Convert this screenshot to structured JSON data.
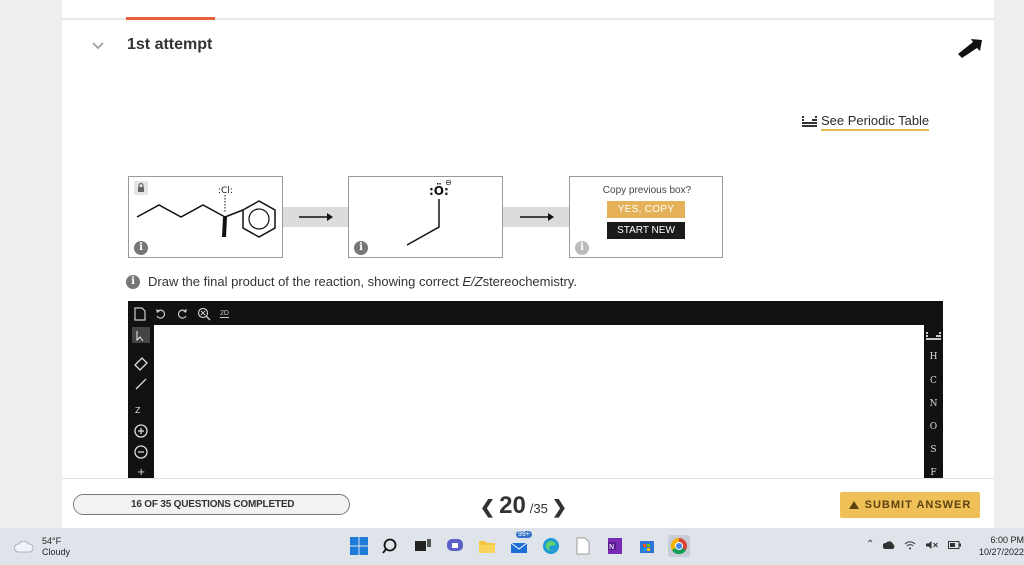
{
  "attempt": {
    "title": "1st attempt"
  },
  "periodic": {
    "label": "See Periodic Table"
  },
  "copy_box": {
    "question": "Copy previous box?",
    "yes_label": "YES, COPY",
    "start_label": "START NEW"
  },
  "instruction": {
    "prefix": "Draw the final product of the reaction, showing correct ",
    "italic": "E/Z",
    "suffix": "stereochemistry."
  },
  "reagent": {
    "label": ":Ö:",
    "charge": "⊖"
  },
  "toolbar": {
    "ring_label": "2D"
  },
  "elements": [
    "H",
    "C",
    "N",
    "O",
    "S",
    "F"
  ],
  "progress": {
    "label": "16 OF 35 QUESTIONS COMPLETED",
    "completed": 16,
    "total": 35
  },
  "pager": {
    "current": "20",
    "total": "/35"
  },
  "submit": {
    "label": "SUBMIT ANSWER"
  },
  "weather": {
    "temp": "54°F",
    "cond": "Cloudy"
  },
  "clock": {
    "time": "6:00 PM",
    "date": "10/27/2022"
  },
  "taskbar": {
    "badge": "99+"
  },
  "colors": {
    "accent": "#e8603c",
    "submit": "#efc058",
    "yes": "#e5b25a"
  }
}
